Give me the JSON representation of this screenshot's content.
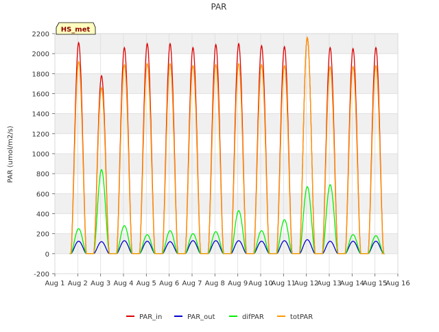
{
  "chart_data": {
    "type": "line",
    "title": "PAR",
    "xlabel": "",
    "ylabel": "PAR (umol/m2/s)",
    "xlim": [
      1,
      16
    ],
    "ylim": [
      -200,
      2200
    ],
    "x_tick_labels": [
      "Aug 1",
      "Aug 2",
      "Aug 3",
      "Aug 4",
      "Aug 5",
      "Aug 6",
      "Aug 7",
      "Aug 8",
      "Aug 9",
      "Aug 10",
      "Aug 11",
      "Aug 12",
      "Aug 13",
      "Aug 14",
      "Aug 15",
      "Aug 16"
    ],
    "y_ticks": [
      -200,
      0,
      200,
      400,
      600,
      800,
      1000,
      1200,
      1400,
      1600,
      1800,
      2000,
      2200
    ],
    "grid": true,
    "background_bands": "alternating light grey",
    "station_label": "HS_met",
    "legend_position": "bottom-center",
    "day_of_month": [
      2,
      3,
      4,
      5,
      6,
      7,
      8,
      9,
      10,
      11,
      12,
      13,
      14,
      15
    ],
    "series": [
      {
        "name": "PAR_in",
        "color": "#dd0000",
        "daily_peak": [
          2110,
          1780,
          2060,
          2100,
          2100,
          2060,
          2090,
          2100,
          2080,
          2070,
          2160,
          2060,
          2050,
          2060
        ]
      },
      {
        "name": "PAR_out",
        "color": "#0000cc",
        "daily_peak": [
          125,
          120,
          130,
          125,
          120,
          130,
          130,
          130,
          125,
          130,
          140,
          125,
          125,
          125
        ]
      },
      {
        "name": "difPAR",
        "color": "#00ee00",
        "daily_peak": [
          250,
          840,
          280,
          190,
          230,
          200,
          220,
          430,
          230,
          340,
          670,
          690,
          190,
          180
        ]
      },
      {
        "name": "totPAR",
        "color": "#ff9900",
        "daily_peak": [
          1920,
          1660,
          1890,
          1900,
          1900,
          1880,
          1890,
          1900,
          1890,
          1880,
          2160,
          1870,
          1870,
          1880
        ]
      }
    ]
  }
}
